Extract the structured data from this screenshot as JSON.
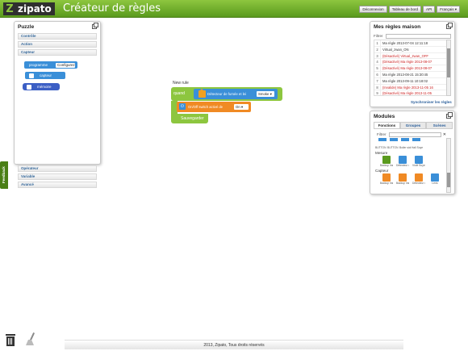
{
  "header": {
    "logo_letter": "Z",
    "logo_text": "zipato",
    "app_title": "Créateur de règles",
    "nav": [
      "Déconnexion",
      "Tableau de bord",
      "API",
      "Français ▾"
    ]
  },
  "puzzle": {
    "title": "Puzzle",
    "categories_top": [
      "Contrôle",
      "Action",
      "Capteur"
    ],
    "blocks": {
      "programme": "programme",
      "configurez": "Configurez",
      "capteur": "capteur",
      "memoire": "mémoire"
    },
    "categories_bottom": [
      "Opérateur",
      "Variable",
      "Avancé"
    ]
  },
  "workspace": {
    "rule_name": "New rule",
    "quand": "quand",
    "detector_label": "Détecteur de fumée et lei",
    "detector_value": "Smoke ▾",
    "action_label": "On/Off switch  activé de",
    "action_value": "On ▾",
    "save": "Sauvegarder"
  },
  "rules_panel": {
    "title": "Mes règles maison",
    "filter_label": "Filtrer",
    "items": [
      {
        "num": "1",
        "text": "Ma règle 2013-07-04 12:11:18",
        "color": "#333333"
      },
      {
        "num": "2",
        "text": "Virtual_zwan_ON",
        "color": "#333333"
      },
      {
        "num": "3",
        "text": "(Désactivé) Virtual_zwan_OFF",
        "color": "#cc2222"
      },
      {
        "num": "4",
        "text": "(Désactivé) Ma règle 2013-08-07",
        "color": "#cc2222"
      },
      {
        "num": "5",
        "text": "(Désactivé) Ma règle 2013-08-07",
        "color": "#cc2222"
      },
      {
        "num": "6",
        "text": "Ma règle 2013-08-21 15:30:45",
        "color": "#333333"
      },
      {
        "num": "7",
        "text": "Ma règle 2013-09-11 10:18:02",
        "color": "#333333"
      },
      {
        "num": "8",
        "text": "(Invalide) Ma règle 2013-11-05 16",
        "color": "#cc2222"
      },
      {
        "num": "9",
        "text": "(Désactivé) Ma règle 2013-11-05",
        "color": "#cc2222"
      }
    ],
    "sync": "Synchroniser les règles"
  },
  "modules_panel": {
    "title": "Modules",
    "tabs": [
      "Fonctions",
      "Groupes",
      "Scènes"
    ],
    "filter_label": "Filtrer",
    "clear_icon": "✕",
    "strip_labels": [
      "BUTTON",
      "BUTTON",
      "Boiler sider",
      "Hall Suyen"
    ],
    "sections": [
      {
        "title": "Mesure",
        "items": [
          {
            "label": "Backup Inslu",
            "color": "#5a9a1e"
          },
          {
            "label": "Détecteur de",
            "color": "#3a8fd8"
          },
          {
            "label": "Violé Suyen",
            "color": "#3a8fd8"
          }
        ]
      },
      {
        "title": "Capteur",
        "items": [
          {
            "label": "Backup Inslu",
            "color": "#f08a24"
          },
          {
            "label": "Backup Inslu",
            "color": "#f08a24"
          },
          {
            "label": "Détecteur de",
            "color": "#f08a24"
          },
          {
            "label": "Lens",
            "color": "#3a8fd8"
          }
        ]
      }
    ]
  },
  "feedback": "Feedback",
  "footer": "2013, Zipato, Tous droits réservés"
}
